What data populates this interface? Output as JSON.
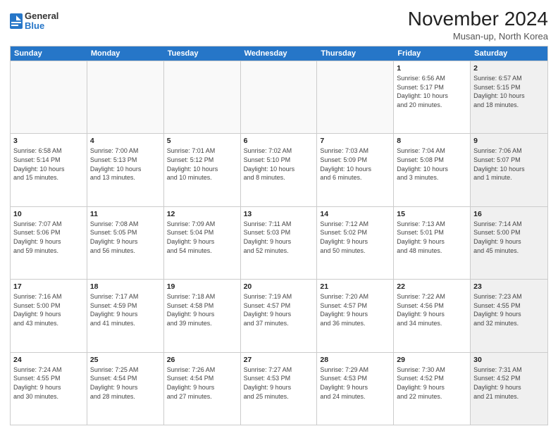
{
  "logo": {
    "general": "General",
    "blue": "Blue"
  },
  "title": "November 2024",
  "location": "Musan-up, North Korea",
  "days_of_week": [
    "Sunday",
    "Monday",
    "Tuesday",
    "Wednesday",
    "Thursday",
    "Friday",
    "Saturday"
  ],
  "rows": [
    [
      {
        "day": "",
        "info": "",
        "empty": true
      },
      {
        "day": "",
        "info": "",
        "empty": true
      },
      {
        "day": "",
        "info": "",
        "empty": true
      },
      {
        "day": "",
        "info": "",
        "empty": true
      },
      {
        "day": "",
        "info": "",
        "empty": true
      },
      {
        "day": "1",
        "info": "Sunrise: 6:56 AM\nSunset: 5:17 PM\nDaylight: 10 hours\nand 20 minutes.",
        "empty": false,
        "shaded": false
      },
      {
        "day": "2",
        "info": "Sunrise: 6:57 AM\nSunset: 5:15 PM\nDaylight: 10 hours\nand 18 minutes.",
        "empty": false,
        "shaded": true
      }
    ],
    [
      {
        "day": "3",
        "info": "Sunrise: 6:58 AM\nSunset: 5:14 PM\nDaylight: 10 hours\nand 15 minutes.",
        "empty": false,
        "shaded": false
      },
      {
        "day": "4",
        "info": "Sunrise: 7:00 AM\nSunset: 5:13 PM\nDaylight: 10 hours\nand 13 minutes.",
        "empty": false,
        "shaded": false
      },
      {
        "day": "5",
        "info": "Sunrise: 7:01 AM\nSunset: 5:12 PM\nDaylight: 10 hours\nand 10 minutes.",
        "empty": false,
        "shaded": false
      },
      {
        "day": "6",
        "info": "Sunrise: 7:02 AM\nSunset: 5:10 PM\nDaylight: 10 hours\nand 8 minutes.",
        "empty": false,
        "shaded": false
      },
      {
        "day": "7",
        "info": "Sunrise: 7:03 AM\nSunset: 5:09 PM\nDaylight: 10 hours\nand 6 minutes.",
        "empty": false,
        "shaded": false
      },
      {
        "day": "8",
        "info": "Sunrise: 7:04 AM\nSunset: 5:08 PM\nDaylight: 10 hours\nand 3 minutes.",
        "empty": false,
        "shaded": false
      },
      {
        "day": "9",
        "info": "Sunrise: 7:06 AM\nSunset: 5:07 PM\nDaylight: 10 hours\nand 1 minute.",
        "empty": false,
        "shaded": true
      }
    ],
    [
      {
        "day": "10",
        "info": "Sunrise: 7:07 AM\nSunset: 5:06 PM\nDaylight: 9 hours\nand 59 minutes.",
        "empty": false,
        "shaded": false
      },
      {
        "day": "11",
        "info": "Sunrise: 7:08 AM\nSunset: 5:05 PM\nDaylight: 9 hours\nand 56 minutes.",
        "empty": false,
        "shaded": false
      },
      {
        "day": "12",
        "info": "Sunrise: 7:09 AM\nSunset: 5:04 PM\nDaylight: 9 hours\nand 54 minutes.",
        "empty": false,
        "shaded": false
      },
      {
        "day": "13",
        "info": "Sunrise: 7:11 AM\nSunset: 5:03 PM\nDaylight: 9 hours\nand 52 minutes.",
        "empty": false,
        "shaded": false
      },
      {
        "day": "14",
        "info": "Sunrise: 7:12 AM\nSunset: 5:02 PM\nDaylight: 9 hours\nand 50 minutes.",
        "empty": false,
        "shaded": false
      },
      {
        "day": "15",
        "info": "Sunrise: 7:13 AM\nSunset: 5:01 PM\nDaylight: 9 hours\nand 48 minutes.",
        "empty": false,
        "shaded": false
      },
      {
        "day": "16",
        "info": "Sunrise: 7:14 AM\nSunset: 5:00 PM\nDaylight: 9 hours\nand 45 minutes.",
        "empty": false,
        "shaded": true
      }
    ],
    [
      {
        "day": "17",
        "info": "Sunrise: 7:16 AM\nSunset: 5:00 PM\nDaylight: 9 hours\nand 43 minutes.",
        "empty": false,
        "shaded": false
      },
      {
        "day": "18",
        "info": "Sunrise: 7:17 AM\nSunset: 4:59 PM\nDaylight: 9 hours\nand 41 minutes.",
        "empty": false,
        "shaded": false
      },
      {
        "day": "19",
        "info": "Sunrise: 7:18 AM\nSunset: 4:58 PM\nDaylight: 9 hours\nand 39 minutes.",
        "empty": false,
        "shaded": false
      },
      {
        "day": "20",
        "info": "Sunrise: 7:19 AM\nSunset: 4:57 PM\nDaylight: 9 hours\nand 37 minutes.",
        "empty": false,
        "shaded": false
      },
      {
        "day": "21",
        "info": "Sunrise: 7:20 AM\nSunset: 4:57 PM\nDaylight: 9 hours\nand 36 minutes.",
        "empty": false,
        "shaded": false
      },
      {
        "day": "22",
        "info": "Sunrise: 7:22 AM\nSunset: 4:56 PM\nDaylight: 9 hours\nand 34 minutes.",
        "empty": false,
        "shaded": false
      },
      {
        "day": "23",
        "info": "Sunrise: 7:23 AM\nSunset: 4:55 PM\nDaylight: 9 hours\nand 32 minutes.",
        "empty": false,
        "shaded": true
      }
    ],
    [
      {
        "day": "24",
        "info": "Sunrise: 7:24 AM\nSunset: 4:55 PM\nDaylight: 9 hours\nand 30 minutes.",
        "empty": false,
        "shaded": false
      },
      {
        "day": "25",
        "info": "Sunrise: 7:25 AM\nSunset: 4:54 PM\nDaylight: 9 hours\nand 28 minutes.",
        "empty": false,
        "shaded": false
      },
      {
        "day": "26",
        "info": "Sunrise: 7:26 AM\nSunset: 4:54 PM\nDaylight: 9 hours\nand 27 minutes.",
        "empty": false,
        "shaded": false
      },
      {
        "day": "27",
        "info": "Sunrise: 7:27 AM\nSunset: 4:53 PM\nDaylight: 9 hours\nand 25 minutes.",
        "empty": false,
        "shaded": false
      },
      {
        "day": "28",
        "info": "Sunrise: 7:29 AM\nSunset: 4:53 PM\nDaylight: 9 hours\nand 24 minutes.",
        "empty": false,
        "shaded": false
      },
      {
        "day": "29",
        "info": "Sunrise: 7:30 AM\nSunset: 4:52 PM\nDaylight: 9 hours\nand 22 minutes.",
        "empty": false,
        "shaded": false
      },
      {
        "day": "30",
        "info": "Sunrise: 7:31 AM\nSunset: 4:52 PM\nDaylight: 9 hours\nand 21 minutes.",
        "empty": false,
        "shaded": true
      }
    ]
  ]
}
